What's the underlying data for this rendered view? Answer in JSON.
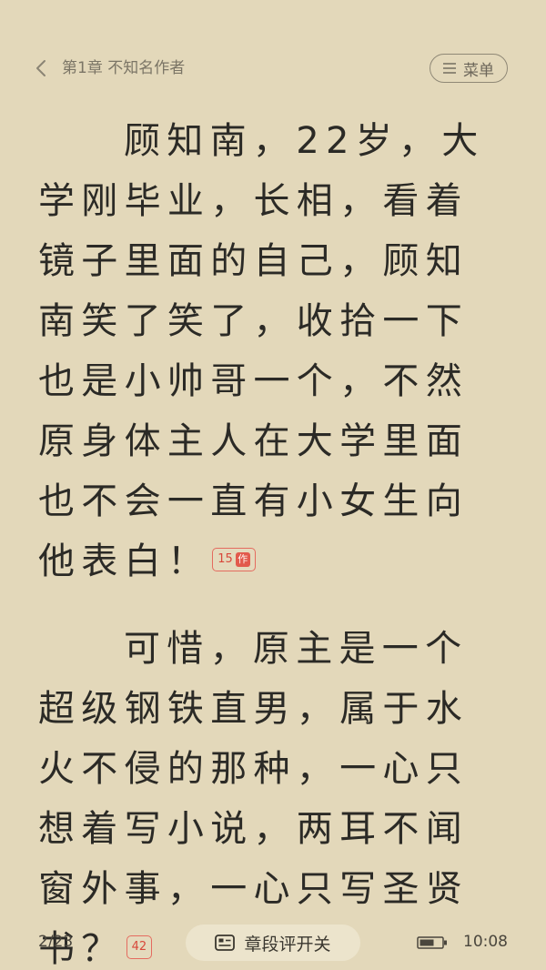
{
  "header": {
    "chapter_title": "第1章 不知名作者",
    "menu_label": "菜单"
  },
  "content": {
    "paragraphs": [
      {
        "text": "顾知南，22岁，大学刚毕业，长相，看着镜子里面的自己，顾知南笑了笑了，收拾一下也是小帅哥一个，不然原身体主人在大学里面也不会一直有小女生向他表白！",
        "comment_count": "15",
        "author_badge": "作"
      },
      {
        "text": "可惜，原主是一个超级钢铁直男，属于水火不侵的那种，一心只想着写小说，两耳不闻窗外事，一心只写圣贤书？",
        "comment_count": "42"
      }
    ]
  },
  "footer": {
    "page_indicator": "2/23",
    "comment_toggle_label": "章段评开关",
    "time": "10:08"
  },
  "colors": {
    "background": "#e3d8ba",
    "text": "#2b2a26",
    "badge_red": "#e25a4c"
  },
  "icons": {
    "back": "chevron-left-icon",
    "menu": "hamburger-icon",
    "comment_toggle": "comment-toggle-icon",
    "battery": "battery-icon"
  }
}
